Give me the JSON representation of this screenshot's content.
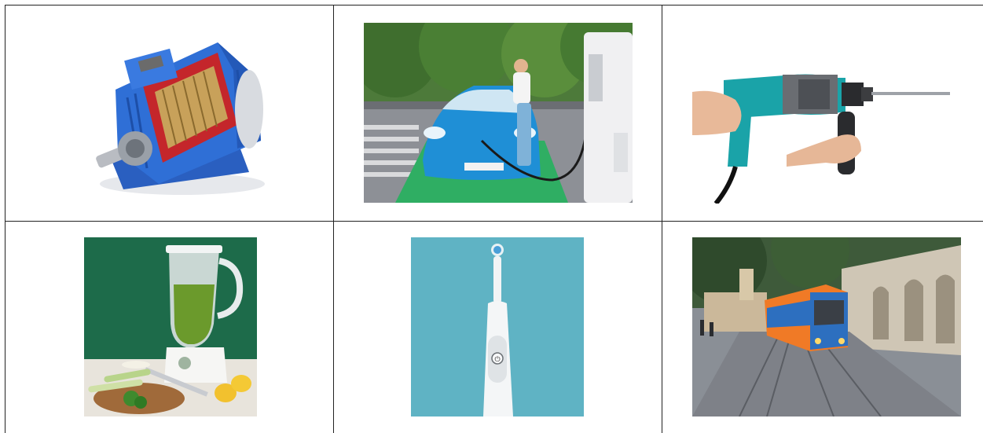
{
  "images": [
    {
      "id": "electric-motor",
      "alt": ""
    },
    {
      "id": "ev-charging",
      "alt": ""
    },
    {
      "id": "power-drill",
      "alt": ""
    },
    {
      "id": "blender",
      "alt": ""
    },
    {
      "id": "electric-toothbrush",
      "alt": ""
    },
    {
      "id": "tram",
      "alt": ""
    }
  ],
  "colors": {
    "grid_line": "#222222",
    "motor_blue": "#2f6fd6",
    "car_blue": "#1f8fd6",
    "drill_teal": "#1aa3a8",
    "blender_green_bg": "#1d6b4a",
    "toothbrush_bg": "#5fb3c4",
    "tram_orange": "#f07a26"
  }
}
